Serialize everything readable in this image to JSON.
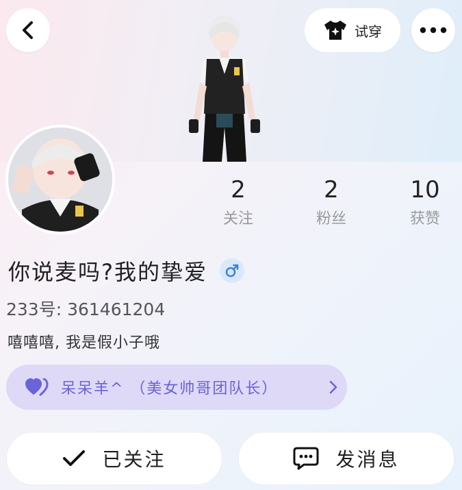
{
  "header": {
    "try_on_label": "试穿"
  },
  "stats": [
    {
      "value": "2",
      "label": "关注"
    },
    {
      "value": "2",
      "label": "粉丝"
    },
    {
      "value": "10",
      "label": "获赞"
    }
  ],
  "profile": {
    "name": "你说麦吗?我的挚爱",
    "uid": "233号: 361461204",
    "bio": "嘻嘻嘻, 我是假小子哦",
    "gender": "male"
  },
  "cp_banner": {
    "text": "呆呆羊^ （美女帅哥团队长）"
  },
  "actions": {
    "follow_label": "已关注",
    "message_label": "发消息"
  },
  "colors": {
    "accent_purple": "#6b63d8",
    "banner_bg": "#ddd9f7",
    "gender_blue": "#3c82e6"
  }
}
